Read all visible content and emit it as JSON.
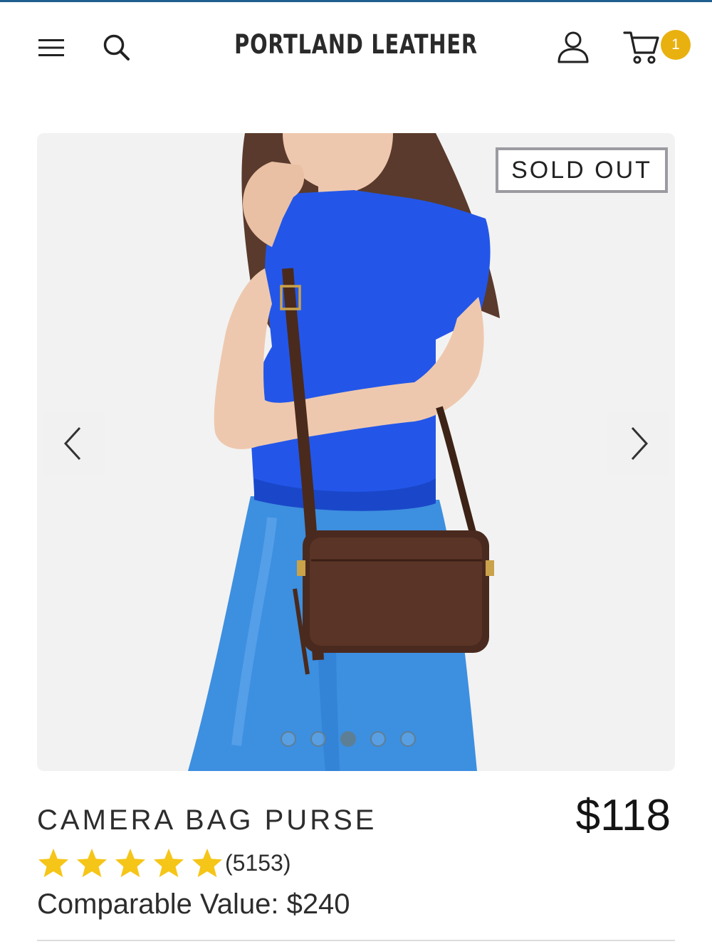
{
  "brand": {
    "logo_text": "PORTLAND LEATHER"
  },
  "header": {
    "menu_icon": "hamburger-menu-icon",
    "search_icon": "search-icon",
    "account_icon": "user-icon",
    "cart_icon": "cart-icon",
    "cart_count": "1"
  },
  "gallery": {
    "badge": "SOLD OUT",
    "prev_icon": "chevron-left-icon",
    "next_icon": "chevron-right-icon",
    "image_count": 5,
    "active_index": 2
  },
  "product": {
    "title": "CAMERA BAG PURSE",
    "price": "$118",
    "rating_stars": 5,
    "reviews": "(5153)",
    "comparable_value": "Comparable Value: $240"
  },
  "colors": {
    "accent_topline": "#1f5f8f",
    "badge_yellow": "#e9b10f",
    "star": "#f5c518",
    "dot": "#5d7f95"
  }
}
